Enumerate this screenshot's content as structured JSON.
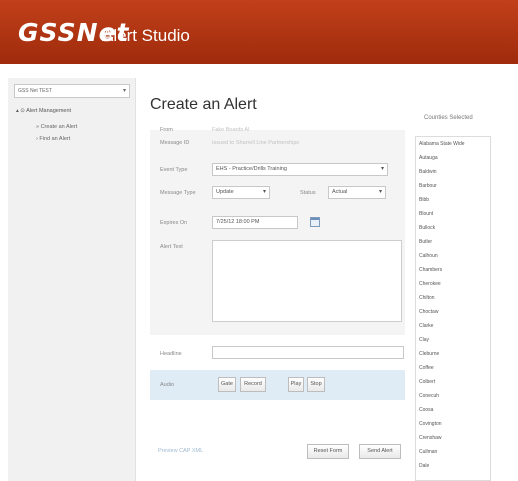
{
  "header": {
    "logo": "GSSNet",
    "app_title": "Alert Studio"
  },
  "sidebar": {
    "select_value": "GSS Net TEST",
    "root": "▴ ⊙ Alert Management",
    "items": [
      {
        "label": "» Create an Alert"
      },
      {
        "label": "› Find an Alert"
      }
    ]
  },
  "main": {
    "title": "Create an Alert",
    "form": {
      "from_label": "From",
      "from_value": "Fake Boards Al",
      "message_id_label": "Message ID",
      "message_id_value": "Issued to Sharrell Line Partnerships",
      "event_type_label": "Event Type",
      "event_type_value": "EHS - Practice/Drills Training",
      "message_type_label": "Message Type",
      "message_type_value": "Update",
      "status_label": "Status",
      "status_value": "Actual",
      "expires_label": "Expires On",
      "expires_value": "7/25/12 18:00 PM",
      "alert_text_label": "Alert Text",
      "headline_label": "Headline",
      "audio_label": "Audio",
      "audio_buttons": [
        "Gate",
        "Record",
        "Play",
        "Stop"
      ],
      "preview_link": "Preview CAP XML",
      "reset_button": "Reset Form",
      "send_button": "Send Alert"
    }
  },
  "counties": {
    "title": "Counties Selected",
    "items": [
      "Alabama State Wide",
      "Autauga",
      "Baldwin",
      "Barbour",
      "Bibb",
      "Blount",
      "Bullock",
      "Butler",
      "Calhoun",
      "Chambers",
      "Cherokee",
      "Chilton",
      "Choctaw",
      "Clarke",
      "Clay",
      "Cleburne",
      "Coffee",
      "Colbert",
      "Conecuh",
      "Coosa",
      "Covington",
      "Crenshaw",
      "Cullman",
      "Dale"
    ]
  }
}
